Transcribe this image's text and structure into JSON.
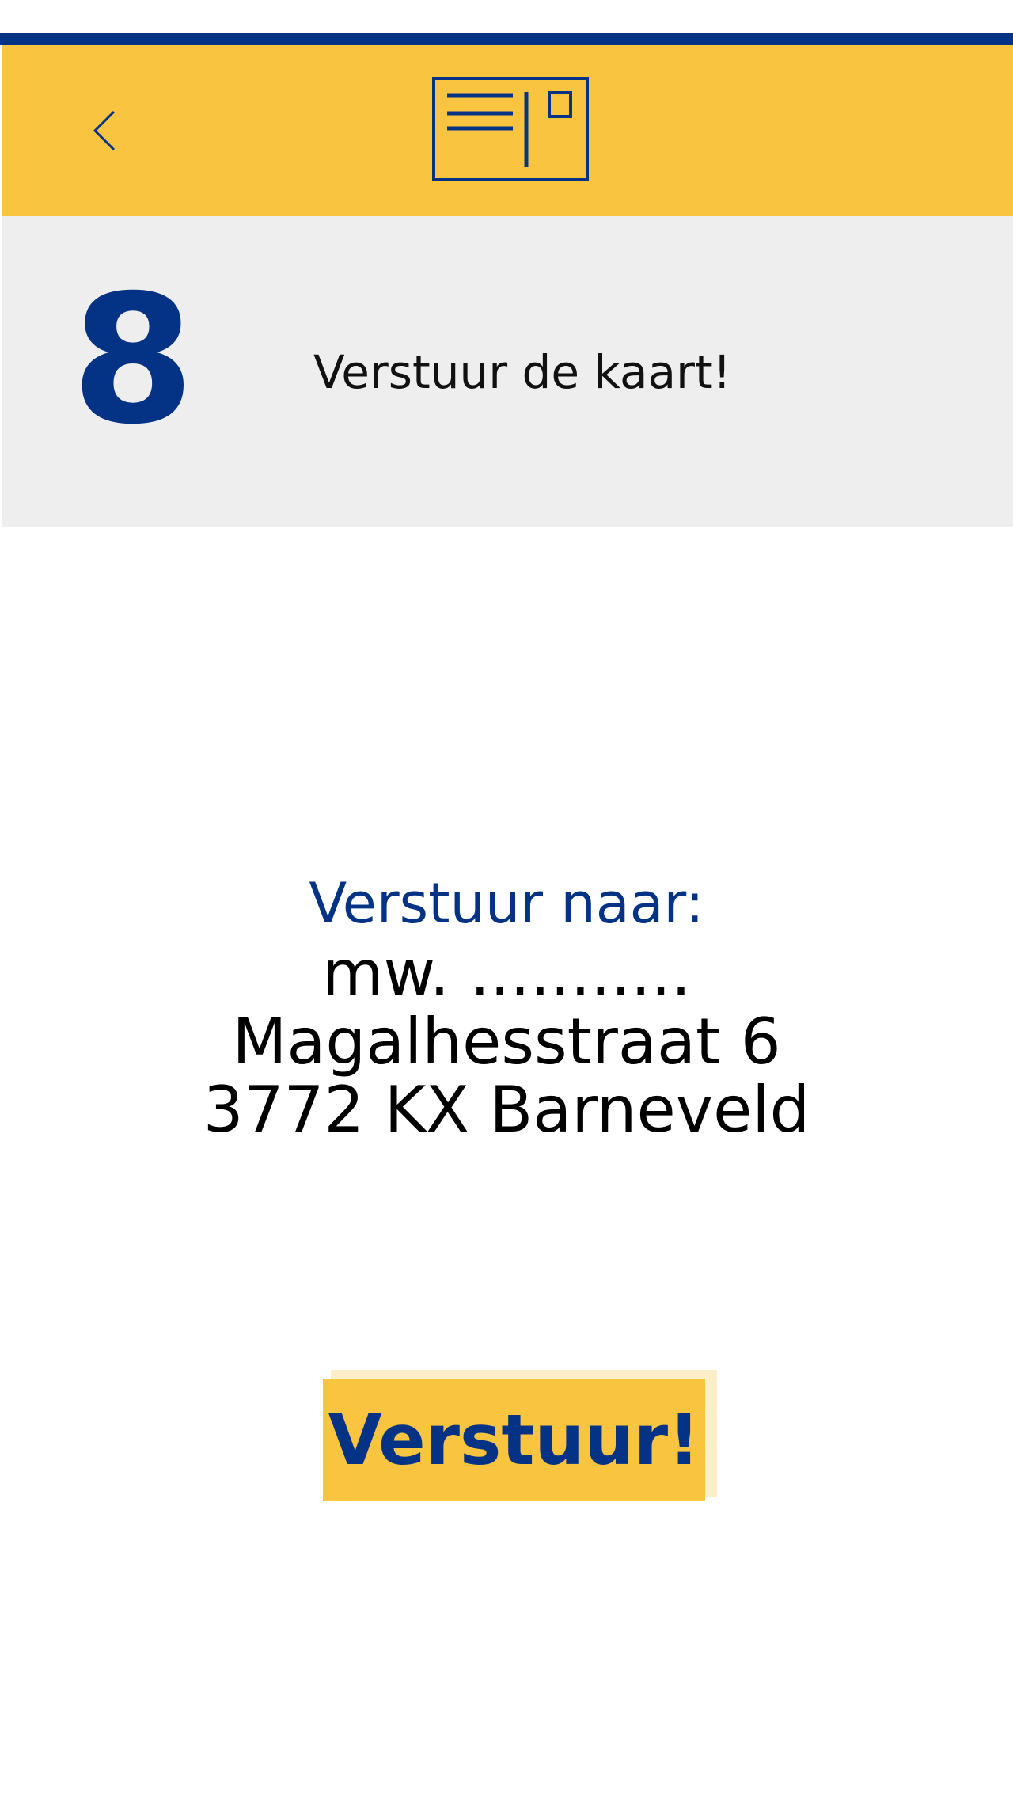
{
  "colors": {
    "brand_blue": "#043385",
    "brand_yellow": "#f9c541",
    "band_grey": "#eeeeee"
  },
  "header": {
    "back_icon": "chevron-left-icon",
    "logo_icon": "postcard-icon"
  },
  "step": {
    "number": "8",
    "title": "Verstuur de kaart!"
  },
  "address": {
    "label": "Verstuur naar:",
    "recipient": "mw. ...........",
    "street": "Magalhesstraat 6",
    "postal_city": "3772 KX Barneveld"
  },
  "actions": {
    "send_label": "Verstuur!"
  }
}
